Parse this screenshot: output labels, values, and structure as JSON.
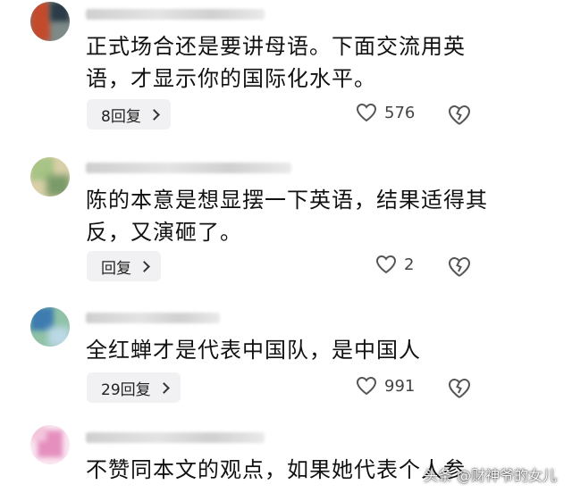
{
  "comments": [
    {
      "text_line1": "正式场合还是要讲母语。下面交流用英",
      "text_line2": "语，才显示你的国际化水平。",
      "reply_label": "8回复",
      "likes": "576",
      "avatar_colors": [
        "#c44a2c",
        "#7d8a88",
        "#2b3b47"
      ]
    },
    {
      "text_line1": "陈的本意是想显摆一下英语，结果适得其",
      "text_line2": "反，又演砸了。",
      "reply_label": "回复",
      "likes": "2",
      "avatar_colors": [
        "#a7c486",
        "#d9d0a8",
        "#7a9a6a"
      ]
    },
    {
      "text_line1": "全红蝉才是代表中国队，是中国人",
      "reply_label": "29回复",
      "likes": "991",
      "avatar_colors": [
        "#3e7bb0",
        "#8fc2a7",
        "#bcd8e6"
      ]
    },
    {
      "text_line1": "不赞同本文的观点，如果她代表个人参",
      "avatar_colors": [
        "#f3c6dc",
        "#e58fbf",
        "#fbe6f0"
      ]
    }
  ],
  "watermark": "头条 @财神爷的女儿"
}
